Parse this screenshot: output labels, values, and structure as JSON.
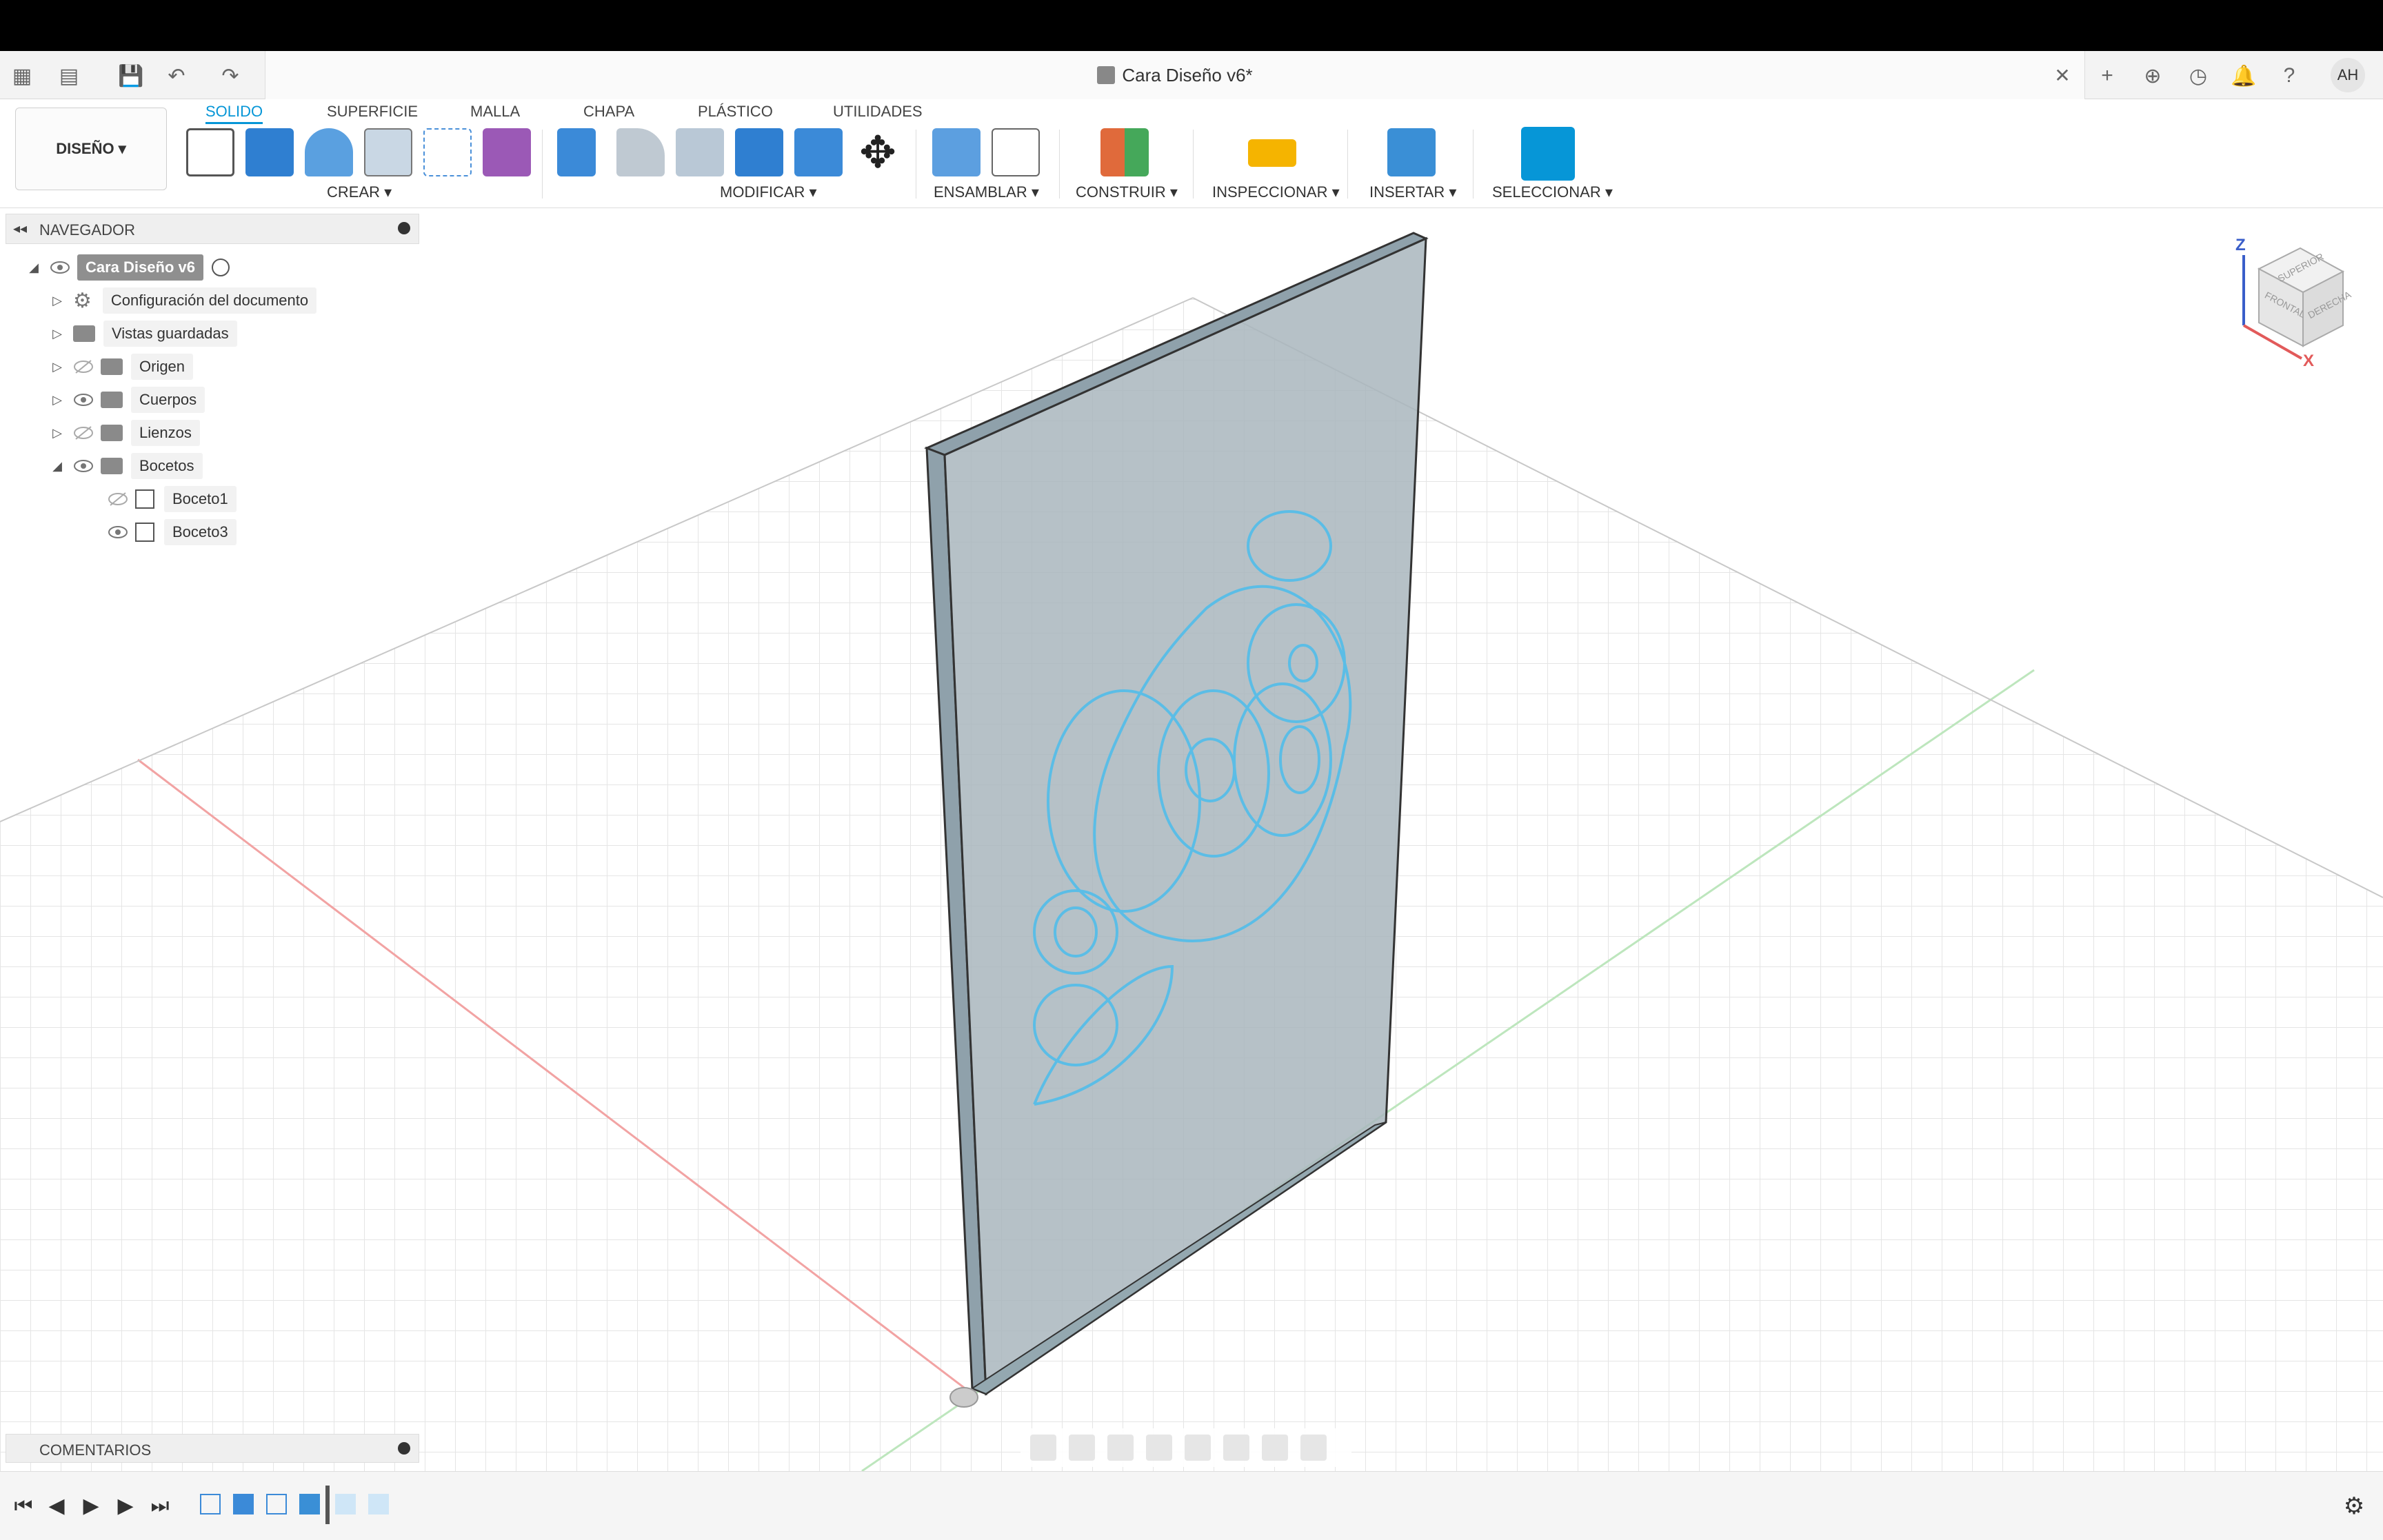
{
  "window": {
    "title": "Cara Diseño v6*"
  },
  "workspace": {
    "label": "DISEÑO ▾"
  },
  "ribbon": {
    "tabs": [
      "SOLIDO",
      "SUPERFICIE",
      "MALLA",
      "CHAPA",
      "PLÁSTICO",
      "UTILIDADES"
    ],
    "groups": {
      "crear": "CREAR ▾",
      "modificar": "MODIFICAR ▾",
      "ensamblar": "ENSAMBLAR ▾",
      "construir": "CONSTRUIR ▾",
      "inspeccionar": "INSPECCIONAR ▾",
      "insertar": "INSERTAR ▾",
      "seleccionar": "SELECCIONAR ▾"
    }
  },
  "user": {
    "initials": "AH"
  },
  "navigator": {
    "title": "NAVEGADOR",
    "root": "Cara Diseño v6",
    "items": [
      {
        "label": "Configuración del documento"
      },
      {
        "label": "Vistas guardadas"
      },
      {
        "label": "Origen"
      },
      {
        "label": "Cuerpos"
      },
      {
        "label": "Lienzos"
      },
      {
        "label": "Bocetos"
      },
      {
        "label": "Boceto1"
      },
      {
        "label": "Boceto3"
      }
    ]
  },
  "comments": {
    "title": "COMENTARIOS"
  },
  "viewcube": {
    "top": "SUPERIOR",
    "front": "FRONTAL",
    "right": "DERECHA",
    "axis_z": "Z",
    "axis_x": "X"
  },
  "colors": {
    "accent": "#0696d7",
    "sketch": "#5bbde6",
    "body": "#a9b6bd"
  }
}
